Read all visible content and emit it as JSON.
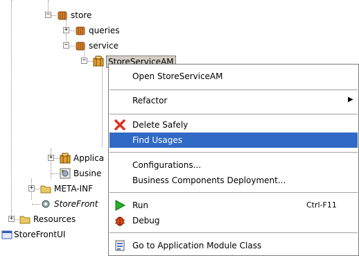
{
  "tree": {
    "store": "store",
    "queries": "queries",
    "service": "service",
    "store_service_am": "StoreServiceAM",
    "application": "Applica",
    "business": "Busine",
    "meta_inf": "META-INF",
    "storefront_italic": "StoreFront",
    "resources": "Resources",
    "storefrontui": "StoreFrontUI"
  },
  "context_menu": {
    "open": "Open StoreServiceAM",
    "refactor": "Refactor",
    "refactor_arrow": "▶",
    "delete_safely": "Delete Safely",
    "find_usages": "Find Usages",
    "configurations": "Configurations...",
    "business_components_deployment": "Business Components Deployment...",
    "run": "Run",
    "run_shortcut": "Ctrl-F11",
    "debug": "Debug",
    "goto_class": "Go to Application Module Class"
  },
  "colors": {
    "highlight": "#316ac5",
    "folder": "#e8c860",
    "package": "#d9822b"
  }
}
